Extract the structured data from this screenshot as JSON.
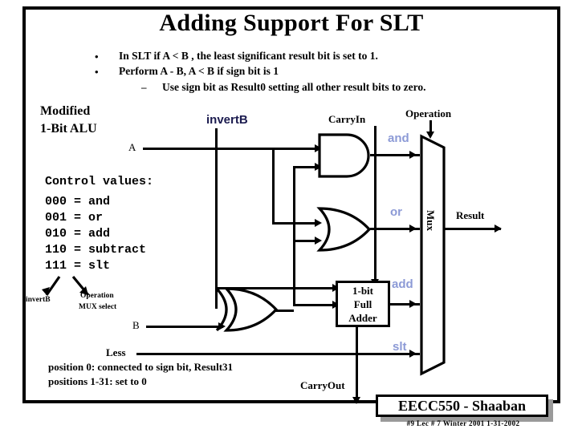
{
  "slide": {
    "title": "Adding Support For SLT",
    "bullets": [
      {
        "marker": "•",
        "text": "In SLT if A < B ,  the least significant result bit is set to 1."
      },
      {
        "marker": "•",
        "text": "Perform  A - B,     A < B if sign bit is 1"
      },
      {
        "marker": "–",
        "text": "Use sign bit as Result0 setting all other result bits to zero."
      }
    ],
    "heading": {
      "line1": "Modified",
      "line2": "1-Bit ALU"
    },
    "control": {
      "header": "Control values:",
      "rows": [
        "000 = and",
        "001 = or",
        "010 = add",
        "110 = subtract",
        "111 = slt"
      ]
    },
    "annotations": {
      "invertB_small": "invertB",
      "operation_small_l1": "Operation",
      "operation_small_l2": "MUX select"
    },
    "signals": {
      "invertB": "invertB",
      "carryIn": "CarryIn",
      "operation": "Operation",
      "a": "A",
      "b": "B",
      "less": "Less",
      "result": "Result",
      "carryOut": "CarryOut"
    },
    "mux_inputs": {
      "and": "and",
      "or": "or",
      "add": "add",
      "slt": "slt"
    },
    "blocks": {
      "mux": "Mux",
      "adder_l1": "1-bit",
      "adder_l2": "Full",
      "adder_l3": "Adder"
    },
    "notes": [
      "position 0:  connected to sign bit, Result31",
      "positions 1-31:   set to 0"
    ],
    "footer": {
      "title": "EECC550 - Shaaban",
      "subtitle": "#9    Lec # 7    Winter 2001   1-31-2002"
    },
    "colors": {
      "mux_input_label": "#8c9ad6",
      "wire": "#000000",
      "background": "#ffffff",
      "footer_shadow": "#9a9a9a"
    }
  }
}
